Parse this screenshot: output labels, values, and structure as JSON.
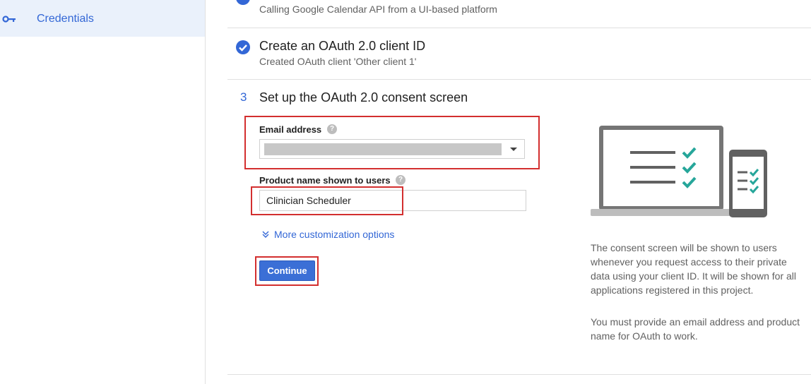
{
  "sidebar": {
    "items": [
      {
        "label": "Credentials",
        "icon": "key-icon"
      }
    ]
  },
  "steps": {
    "step1": {
      "subtitle": "Calling Google Calendar API from a UI-based platform"
    },
    "step2": {
      "title": "Create an OAuth 2.0 client ID",
      "subtitle": "Created OAuth client 'Other client 1'",
      "status": "completed"
    },
    "step3": {
      "number": "3",
      "title": "Set up the OAuth 2.0 consent screen"
    }
  },
  "form": {
    "email_label": "Email address",
    "email_value": "",
    "product_label": "Product name shown to users",
    "product_value": "Clinician Scheduler",
    "more_options": "More customization options",
    "continue_label": "Continue"
  },
  "info": {
    "paragraph1": "The consent screen will be shown to users whenever you request access to their private data using your client ID. It will be shown for all applications registered in this project.",
    "paragraph2": "You must provide an email address and product name for OAuth to work."
  },
  "colors": {
    "accent": "#3367d6",
    "highlight": "#d32f2f",
    "check_green": "#26a69a"
  }
}
